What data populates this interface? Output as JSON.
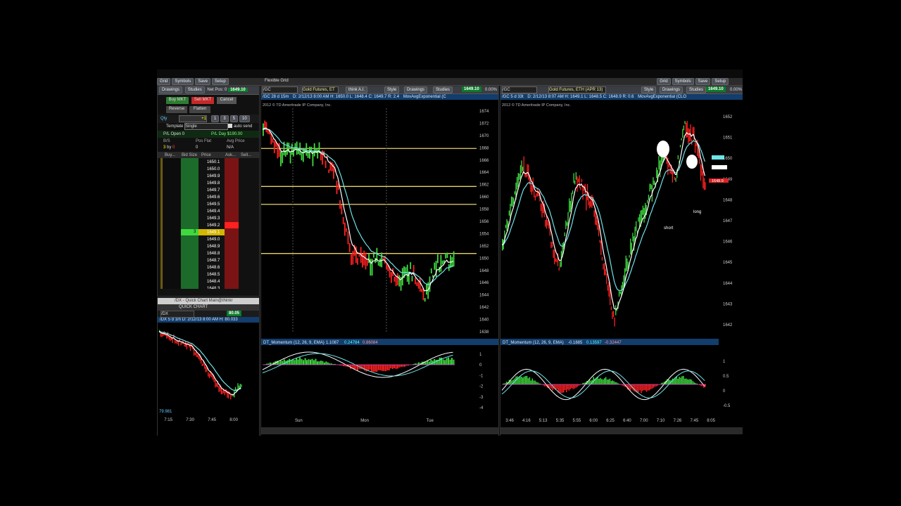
{
  "top_strip": {
    "buttons": [
      "Grid",
      "Symbols",
      "Save",
      "Setup"
    ],
    "buttons_right": [
      "Grid",
      "Symbols",
      "Save",
      "Setup"
    ]
  },
  "window_title": "Flexible Grid",
  "active_trader": {
    "toolbar": {
      "drawings": "Drawings",
      "studies": "Studies",
      "net_pos": "Net Pos: 0",
      "price": "1649.10"
    },
    "buy_mkt": "Buy MKT",
    "sell_mkt": "Sell MKT",
    "cancel": "Cancel",
    "reverse": "Reverse",
    "flatten": "Flatten",
    "qty_label": "Qty",
    "qty_value": "+1",
    "qty_presets": [
      "1",
      "3",
      "5",
      "10"
    ],
    "template_label": "Template",
    "template_value": "Single",
    "auto_send": "auto send",
    "pl_open": "P/L Open 0",
    "pl_day": "P/L Day $190.00",
    "bs_label": "B/S",
    "bs_value_b": "3",
    "bs_by": "by",
    "bs_value_s": "0",
    "pos_flat_label": "Pos Flat",
    "pos_flat_value": "0",
    "avg_price_label": "Avg Price",
    "avg_price_value": "N/A",
    "ladder_headers": [
      "Buy...",
      "Bid Size",
      "Price",
      "Ask...",
      "Sell..."
    ],
    "ladder_prices": [
      "1650.1",
      "1650.0",
      "1649.9",
      "1649.8",
      "1649.7",
      "1649.6",
      "1649.5",
      "1649.4",
      "1649.3",
      "1649.2",
      "1649.1",
      "1649.0",
      "1648.9",
      "1648.8",
      "1648.7",
      "1648.6",
      "1648.5",
      "1648.4",
      "1648.3"
    ],
    "bid_size_current": "3",
    "current_row_index": 10,
    "ask_row_index": 9
  },
  "quick_chart": {
    "title": "/DX - Quick Chart Main@thinkr",
    "tab": "QUICK CHART",
    "symbol": "/DX",
    "price": "80.05",
    "info": "/DX 5 d 1m  D: 2/12/13 8:00 AM  H: 80.033",
    "bottom_value": "79.981",
    "x_ticks": [
      "7:15",
      "7:30",
      "7:45",
      "8:00"
    ]
  },
  "chart_mid": {
    "symbol": "/GC",
    "desc": "Gold Futures, ET",
    "agg": "/GC 28 d 15m",
    "info": "D: 2/12/13 8:00 AM  H: 1650.0  L: 1648.4  C: 1649.7  R: 2.4",
    "study": "MovAvgExponential (C",
    "price": "1649.10",
    "pct": "0.00%",
    "copyright": "2012 © TD Ameritrade IP Company, Inc.",
    "y_ticks": [
      "1674",
      "1672",
      "1670",
      "1668",
      "1666",
      "1664",
      "1662",
      "1660",
      "1658",
      "1656",
      "1654",
      "1652",
      "1650",
      "1648",
      "1646",
      "1644",
      "1642",
      "1640",
      "1638"
    ],
    "x_ticks": [
      "Sun",
      "Mon",
      "Tue"
    ],
    "lower_study": "DT_Momentum (12, 26, 9, EMA)",
    "lower_vals": [
      "1.1087",
      "0.24784",
      "0.86084"
    ],
    "lower_ticks": [
      "1",
      "0",
      "-1",
      "-2",
      "-3",
      "-4"
    ],
    "toolbar_items": [
      "think A.I.",
      "Style",
      "Drawings",
      "Studies"
    ]
  },
  "chart_right": {
    "symbol": "/GC",
    "desc": "Gold Futures, ETH (APR 13)",
    "agg": "/GC 5 d 33t",
    "info": "D: 2/12/13 8:07 AM  H: 1649.1  L: 1648.5  C: 1648.9  R: 0.6",
    "study": "MovAvgExponential (CLO",
    "price": "1649.10",
    "pct": "0.00%",
    "copyright": "2012 © TD Ameritrade IP Company, Inc.",
    "y_ticks": [
      "1652",
      "1651",
      "1650",
      "1649",
      "1648",
      "1647",
      "1646",
      "1645",
      "1644",
      "1643",
      "1642"
    ],
    "x_ticks": [
      "3:46",
      "4:16",
      "5:13",
      "5:35",
      "5:55",
      "6:00",
      "6:25",
      "6:40",
      "7:00",
      "7:10",
      "7:26",
      "7:45",
      "8:05"
    ],
    "lower_study": "DT_Momentum (12, 26, 9, EMA)",
    "lower_vals": [
      "-0.1885",
      "0.13597",
      "-0.32447"
    ],
    "lower_ticks": [
      "1",
      "0.5",
      "0",
      "-0.5"
    ],
    "annotations": [
      "long",
      "short"
    ],
    "current_price_label": "1648.9",
    "toolbar_items": [
      "Style",
      "Drawings",
      "Studies"
    ]
  },
  "colors": {
    "up": "#3fd93f",
    "down": "#ff2020",
    "ema": "#6fe3e8",
    "level": "#e8d267",
    "badge": "#0c7a2a"
  }
}
